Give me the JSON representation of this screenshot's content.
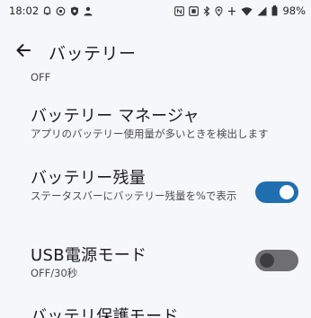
{
  "status_bar": {
    "time": "18:02",
    "battery_percent": "98%",
    "left_icons": [
      "notification-icon",
      "cast-icon",
      "shield-icon",
      "person-icon"
    ],
    "right_icons": [
      "nfc-icon",
      "screen-record-icon",
      "bluetooth-icon",
      "location-icon",
      "data-saver-icon",
      "wifi-icon",
      "signal-icon",
      "battery-icon"
    ]
  },
  "toolbar": {
    "back_icon": "back-arrow-icon",
    "title": "バッテリー"
  },
  "partial_top_summary": "OFF",
  "items": [
    {
      "title": "バッテリー マネージャ",
      "summary": "アプリのバッテリー使用量が多いときを検出します"
    },
    {
      "title": "バッテリー残量",
      "summary": "ステータスバーにバッテリー残量を%で表示",
      "switch_on": true
    },
    {
      "title": "USB電源モード",
      "summary": "OFF/30秒",
      "switch_on": false
    },
    {
      "title": "バッテリ保護モード"
    }
  ],
  "colors": {
    "background": "#f6f7fb",
    "switch_on": "#1f6fb0",
    "switch_off": "#6f6f73"
  }
}
